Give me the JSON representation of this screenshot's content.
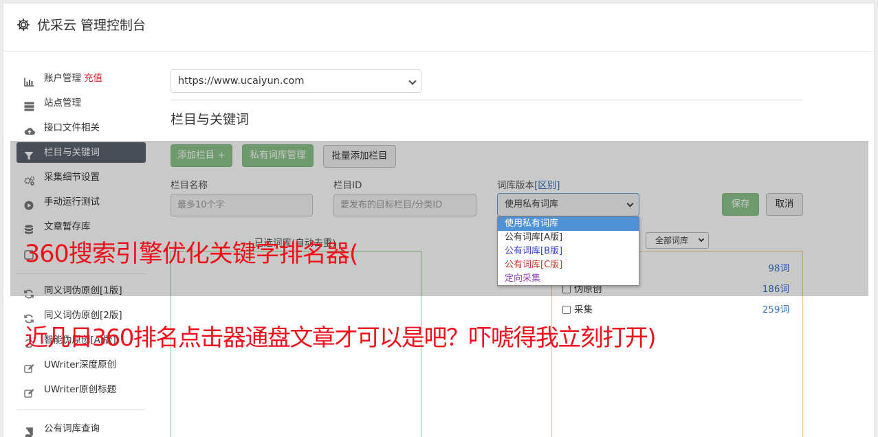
{
  "app": {
    "title": "优采云 管理控制台"
  },
  "sidebar": {
    "items": [
      {
        "label": "账户管理",
        "badge": "充值",
        "icon": "bar-chart-icon"
      },
      {
        "label": "站点管理",
        "icon": "server-icon"
      },
      {
        "label": "接口文件相关",
        "icon": "cloud-upload-icon"
      },
      {
        "label": "栏目与关键词",
        "icon": "filter-icon",
        "active": true
      },
      {
        "label": "采集细节设置",
        "icon": "gears-icon"
      },
      {
        "label": "手动运行测试",
        "icon": "play-circle-icon"
      },
      {
        "label": "文章暂存库",
        "icon": "database-icon"
      },
      {
        "label": "",
        "icon": "blocked-item-icon"
      },
      {
        "label": "同义词伪原创[1版]",
        "icon": "refresh-icon"
      },
      {
        "label": "同义词伪原创[2版]",
        "icon": "refresh-icon"
      },
      {
        "label": "智能伪原创[AI版]",
        "icon": "sync-icon"
      },
      {
        "label": "UWriter深度原创",
        "icon": "edit-icon"
      },
      {
        "label": "UWriter原创标题",
        "icon": "edit-icon"
      },
      {
        "label": "公有词库查询",
        "icon": "book-icon"
      }
    ]
  },
  "site": {
    "selected": "https://www.ucaiyun.com"
  },
  "section": {
    "title": "栏目与关键词"
  },
  "toolbar": {
    "add_column": "添加栏目 +",
    "private_lib": "私有词库管理",
    "batch_add": "批量添加栏目"
  },
  "form": {
    "col_name_label": "栏目名称",
    "col_name_placeholder": "最多10个字",
    "col_id_label": "栏目ID",
    "col_id_placeholder": "要发布的目标栏目/分类ID",
    "lib_version_label": "词库版本",
    "lib_version_link": "[区别]",
    "lib_version_selected": "使用私有词库",
    "save": "保存",
    "cancel": "取消"
  },
  "dropdown": {
    "options": [
      {
        "label": "使用私有词库",
        "color": "#ffffff"
      },
      {
        "label": "公有词库[A版]",
        "color": "#333333"
      },
      {
        "label": "公有词库[B版]",
        "color": "#2f3fbf"
      },
      {
        "label": "公有词库[C版]",
        "color": "#c0392b"
      },
      {
        "label": "定向采集",
        "color": "#8e44ad"
      }
    ]
  },
  "selected_words": {
    "label": "已选词库(自动去重)"
  },
  "library_filter": {
    "selected": "全部词库"
  },
  "libraries": [
    {
      "name": "",
      "count": "98词"
    },
    {
      "name": "伪原创",
      "count": "186词"
    },
    {
      "name": "采集",
      "count": "259词"
    }
  ],
  "promo": {
    "line1": "360搜索引擎优化关键字排名器(",
    "line2": "近几日360排名点击器通盘文章才可以是吧？吓唬得我立刻打开)"
  },
  "colors": {
    "accent_green": "#8cc48c",
    "active_nav": "#5a6370",
    "promo_red": "#f0101b",
    "count_blue": "#3572c5"
  }
}
